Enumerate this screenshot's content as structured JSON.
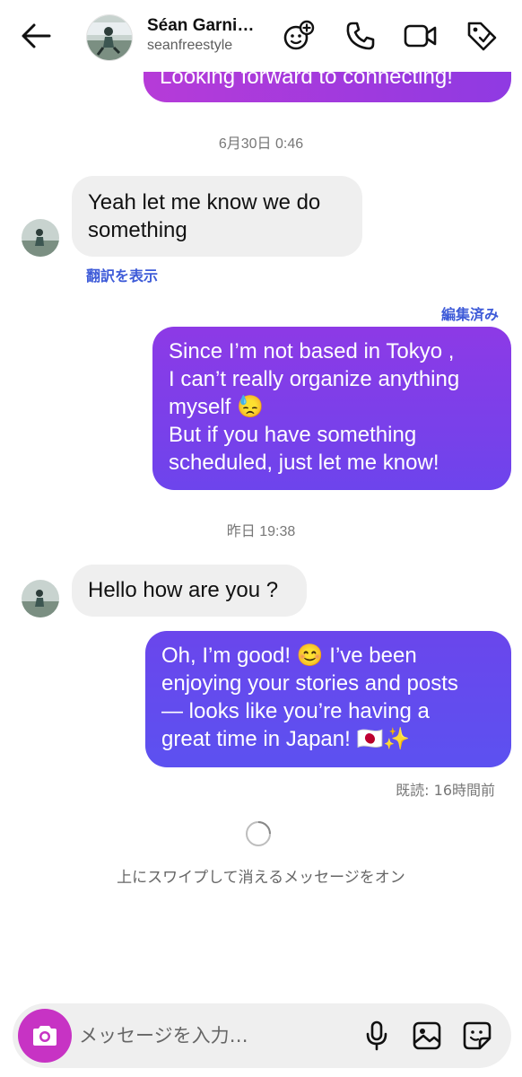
{
  "header": {
    "display_name": "Séan Garni…",
    "username": "seanfreestyle",
    "icons": [
      "back-arrow-icon",
      "sticker-add-icon",
      "phone-icon",
      "video-icon",
      "tag-icon"
    ]
  },
  "messages": {
    "top_cut_text": "Looking forward to connecting!",
    "timestamp_1": "6月30日 0:46",
    "in_1": "Yeah let me know we do\nsomething",
    "translate_label": "翻訳を表示",
    "edited_label": "編集済み",
    "out_1": "Since I’m not based in Tokyo ,\nI can’t really organize anything\nmyself 😓\nBut if you have something\nscheduled, just let me know!",
    "timestamp_2": "昨日 19:38",
    "in_2": "Hello how are you ?",
    "out_2": "Oh, I’m good! 😊 I’ve been\nenjoying your stories and posts\n— looks like you’re having a\ngreat time in Japan! 🇯🇵✨",
    "seen_label": "既読: 16時間前"
  },
  "vanish_mode_text": "上にスワイプして消えるメッセージをオン",
  "composer": {
    "placeholder": "メッセージを入力…",
    "value": "",
    "icons": [
      "camera-icon",
      "microphone-icon",
      "image-icon",
      "sticker-icon"
    ]
  },
  "colors": {
    "accent_link": "#3e5bd8",
    "bubble_out_top": "#8d3ae6",
    "bubble_out_bottom": "#5d4ff0",
    "camera_button": "#c733c4",
    "bubble_in": "#efefef"
  }
}
